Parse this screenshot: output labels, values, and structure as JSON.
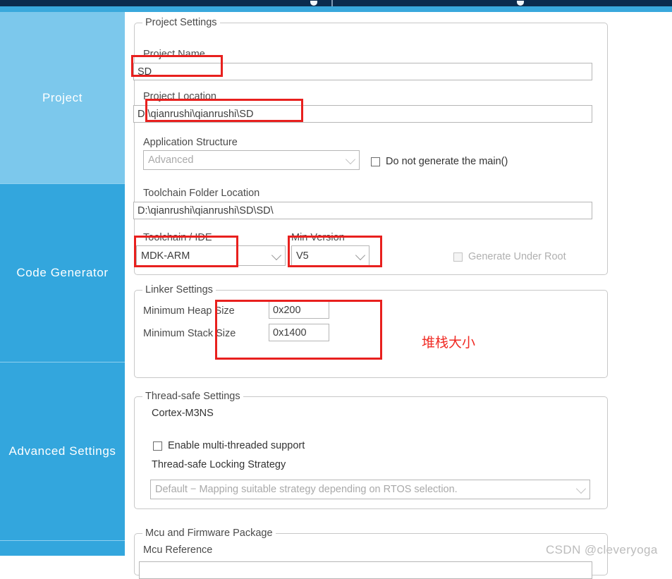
{
  "window": {
    "accent_color": "#39a8dc",
    "titlebar_color": "#0b2b4d"
  },
  "sidebar": {
    "selected_index": 0,
    "selected_color": "#7cc8ec",
    "base_color": "#33a6dd",
    "items": [
      {
        "label": "Project"
      },
      {
        "label": "Code Generator"
      },
      {
        "label": "Advanced Settings"
      },
      {
        "label": ""
      }
    ]
  },
  "project_settings": {
    "title": "Project Settings",
    "project_name_label": "Project Name",
    "project_name_value": "SD",
    "project_location_label": "Project Location",
    "project_location_value": "D:\\qianrushi\\qianrushi\\SD",
    "application_structure_label": "Application Structure",
    "application_structure_value": "Advanced",
    "do_not_generate_main_label": "Do not generate the main()",
    "do_not_generate_main_checked": false,
    "toolchain_folder_label": "Toolchain Folder Location",
    "toolchain_folder_value": "D:\\qianrushi\\qianrushi\\SD\\SD\\",
    "toolchain_ide_label": "Toolchain / IDE",
    "toolchain_ide_value": "MDK-ARM",
    "min_version_label": "Min Version",
    "min_version_value": "V5",
    "generate_under_root_label": "Generate Under Root",
    "generate_under_root_checked": false
  },
  "linker_settings": {
    "title": "Linker Settings",
    "heap_label": "Minimum Heap Size",
    "heap_value": "0x200",
    "stack_label": "Minimum Stack Size",
    "stack_value": "0x1400"
  },
  "thread_safe_settings": {
    "title": "Thread-safe Settings",
    "core_label": "Cortex-M3NS",
    "enable_multithread_label": "Enable multi-threaded support",
    "enable_multithread_checked": false,
    "locking_strategy_label": "Thread-safe Locking Strategy",
    "locking_strategy_value": "Default  −  Mapping suitable strategy depending on RTOS selection."
  },
  "mcu_firmware": {
    "title": "Mcu and Firmware Package",
    "mcu_reference_label": "Mcu Reference"
  },
  "annotations": {
    "stack_note_cn": "堆栈大小",
    "note_color": "#f02a23"
  },
  "watermark": {
    "text": "CSDN @cleveryoga"
  }
}
